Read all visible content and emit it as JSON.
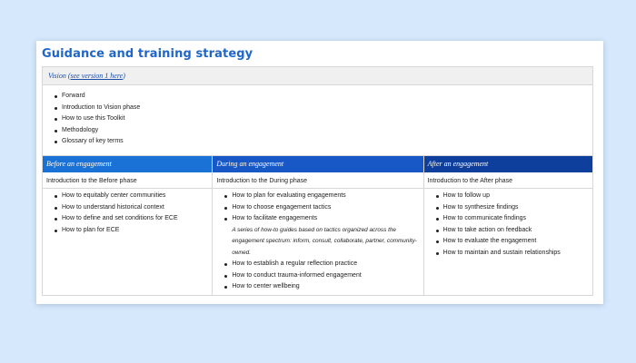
{
  "page": {
    "title": "Guidance and training strategy"
  },
  "vision": {
    "label": "Vision (",
    "link": "see version 1 here",
    "label_end": ")",
    "items": [
      "Forward",
      "Introduction to Vision phase",
      "How to use this Toolkit",
      "Methodology",
      "Glossary of key terms"
    ]
  },
  "phases": [
    {
      "heading": "Before an engagement",
      "intro": "Introduction to the Before phase",
      "items": [
        "How to equitably center communities",
        "How to understand historical context",
        "How to define and set conditions for ECE",
        "How to plan for ECE"
      ]
    },
    {
      "heading": "During an engagement",
      "intro": "Introduction to the During phase",
      "items_a": [
        "How to plan for evaluating engagements",
        "How to choose engagement tactics",
        "How to facilitate engagements"
      ],
      "note": "A series of how-to guides based on tactics organized across the engagement spectrum: inform, consult, collaborate, partner, community-owned.",
      "items_b": [
        "How to establish a regular reflection practice",
        "How to conduct trauma-informed engagement",
        "How to center wellbeing"
      ]
    },
    {
      "heading": "After an engagement",
      "intro": "Introduction to the After phase",
      "items": [
        "How to follow up",
        "How to synthesize findings",
        "How to communicate findings",
        "How to take action on feedback",
        "How to evaluate the engagement",
        "How to maintain and sustain relationships"
      ]
    }
  ],
  "colors": {
    "background": "#d6e8fb",
    "title": "#1f66c8",
    "before_header": "#1a72d6",
    "during_header": "#1858c6",
    "after_header": "#0f3f9c"
  }
}
